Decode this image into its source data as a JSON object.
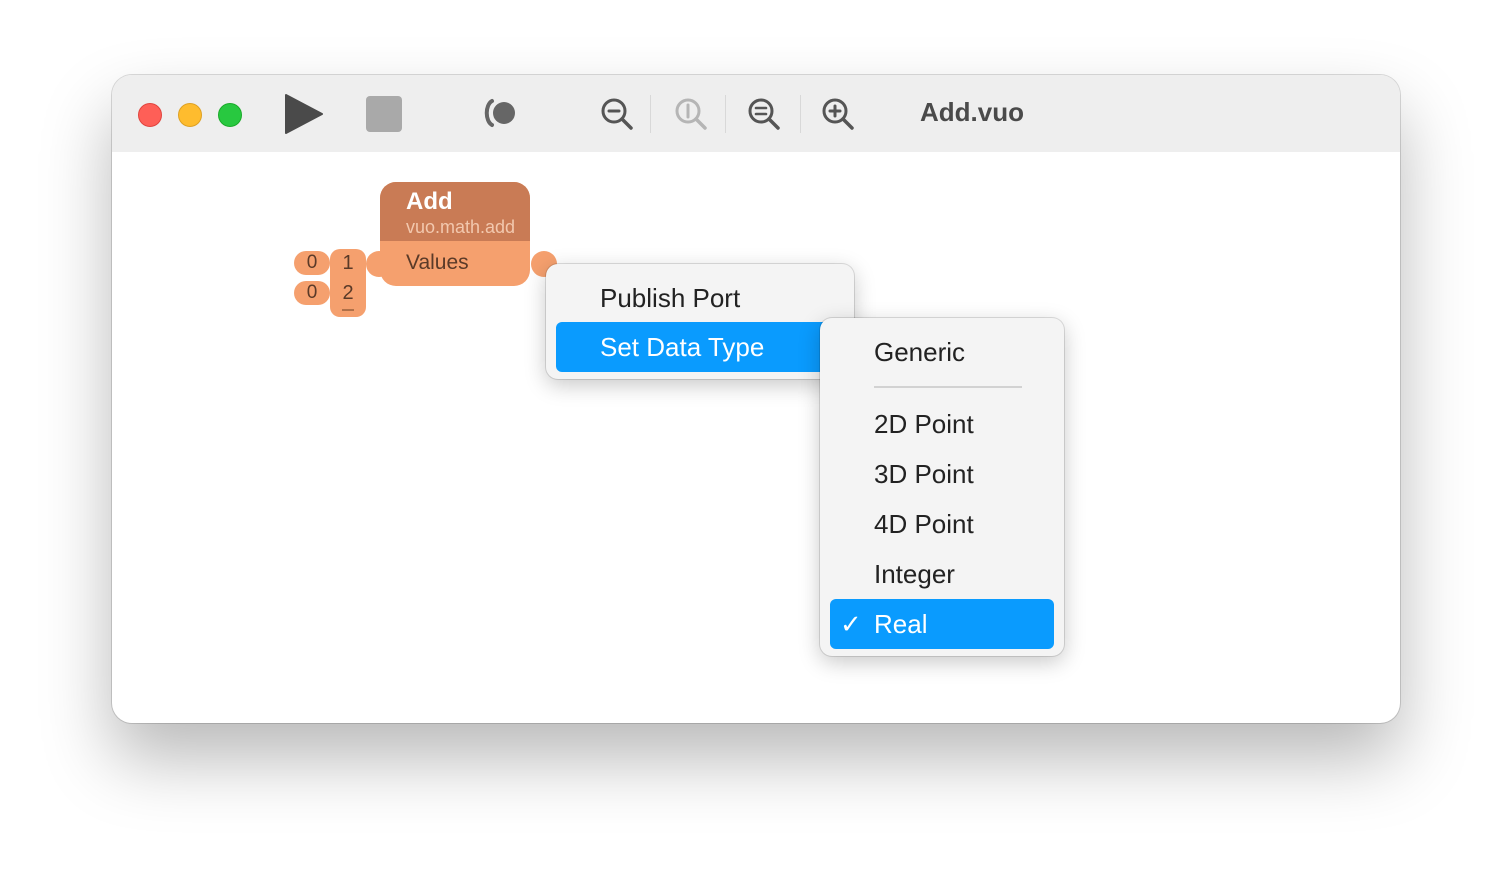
{
  "window": {
    "title": "Add.vuo"
  },
  "toolbar": {
    "run_icon": "play-icon",
    "stop_icon": "stop-icon",
    "show_events_icon": "show-events-icon",
    "zoom_out_icon": "zoom-out-icon",
    "actual_size_icon": "zoom-actual-size-icon",
    "zoom_fit_icon": "zoom-to-fit-icon",
    "zoom_in_icon": "zoom-in-icon"
  },
  "node": {
    "title": "Add",
    "class_name": "vuo.math.add",
    "input_label": "Values",
    "list_items": [
      "1",
      "2"
    ],
    "constants": [
      "0",
      "0"
    ],
    "color": "#f5a06e",
    "header_color": "#c97b55"
  },
  "context_menu": {
    "items": [
      {
        "label": "Publish Port"
      },
      {
        "label": "Set Data Type",
        "submenu_icon": "chevron-right-icon"
      }
    ]
  },
  "submenu": {
    "generic": "Generic",
    "items": [
      {
        "label": "2D Point"
      },
      {
        "label": "3D Point"
      },
      {
        "label": "4D Point"
      },
      {
        "label": "Integer"
      },
      {
        "label": "Real",
        "checked": true,
        "check_glyph": "✓"
      }
    ]
  },
  "colors": {
    "selection": "#0a9bfe",
    "titlebar": "#eeeeee"
  }
}
